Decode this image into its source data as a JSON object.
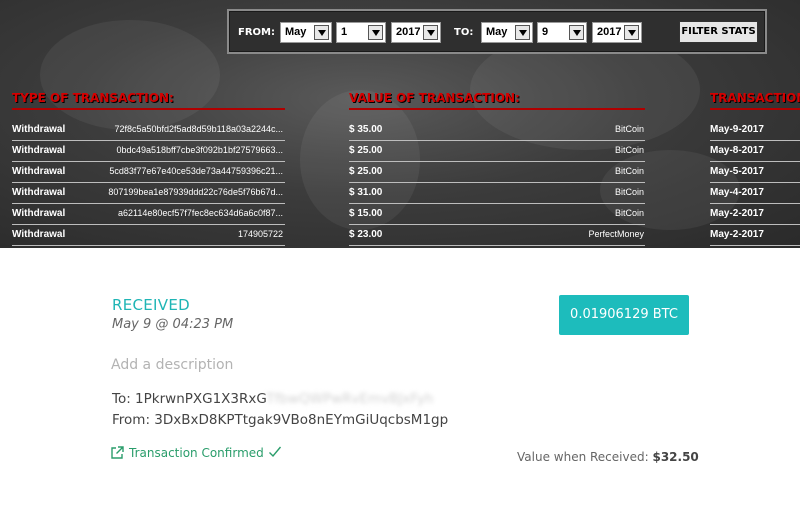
{
  "filter": {
    "from_label": "FROM:",
    "from_month": "May",
    "from_day": "1",
    "from_year": "2017",
    "to_label": "TO:",
    "to_month": "May",
    "to_day": "9",
    "to_year": "2017",
    "button_label": "FILTER STATS"
  },
  "columns": {
    "type_header": "TYPE OF TRANSACTION:",
    "value_header": "VALUE OF TRANSACTION:",
    "date_header": "TRANSACTION"
  },
  "transactions": [
    {
      "type": "Withdrawal",
      "id": "72f8c5a50bfd2f5ad8d59b118a03a2244c...",
      "value": "$ 35.00",
      "method": "BitCoin",
      "date": "May-9-2017"
    },
    {
      "type": "Withdrawal",
      "id": "0bdc49a518bff7cbe3f092b1bf27579663...",
      "value": "$ 25.00",
      "method": "BitCoin",
      "date": "May-8-2017"
    },
    {
      "type": "Withdrawal",
      "id": "5cd83f77e67e40ce53de73a44759396c21...",
      "value": "$ 25.00",
      "method": "BitCoin",
      "date": "May-5-2017"
    },
    {
      "type": "Withdrawal",
      "id": "807199bea1e87939ddd22c76de5f76b67d...",
      "value": "$ 31.00",
      "method": "BitCoin",
      "date": "May-4-2017"
    },
    {
      "type": "Withdrawal",
      "id": "a62114e80ecf57f7fec8ec634d6a6c0f87...",
      "value": "$ 15.00",
      "method": "BitCoin",
      "date": "May-2-2017"
    },
    {
      "type": "Withdrawal",
      "id": "174905722",
      "value": "$ 23.00",
      "method": "PerfectMoney",
      "date": "May-2-2017"
    }
  ],
  "detail": {
    "status": "RECEIVED",
    "datetime": "May 9 @ 04:23 PM",
    "btc_amount": "0.01906129 BTC",
    "description_placeholder": "Add a description",
    "to_prefix": "To: 1PkrwnPXG1X3RxG",
    "to_hidden": "TfbwQWPwRvEmvBJxFyh",
    "from_line": "From: 3DxBxD8KPTtgak9VBo8nEYmGiUqcbsM1gp",
    "confirmed_label": "Transaction Confirmed",
    "value_label": "Value when Received:",
    "value_amount": "$32.50"
  },
  "colors": {
    "accent_teal": "#1dbcbc",
    "confirm_green": "#2a9d6b",
    "header_red": "#d40000"
  },
  "icons": [
    "external-link-icon",
    "checkmark-icon",
    "dropdown-arrow-icon"
  ]
}
